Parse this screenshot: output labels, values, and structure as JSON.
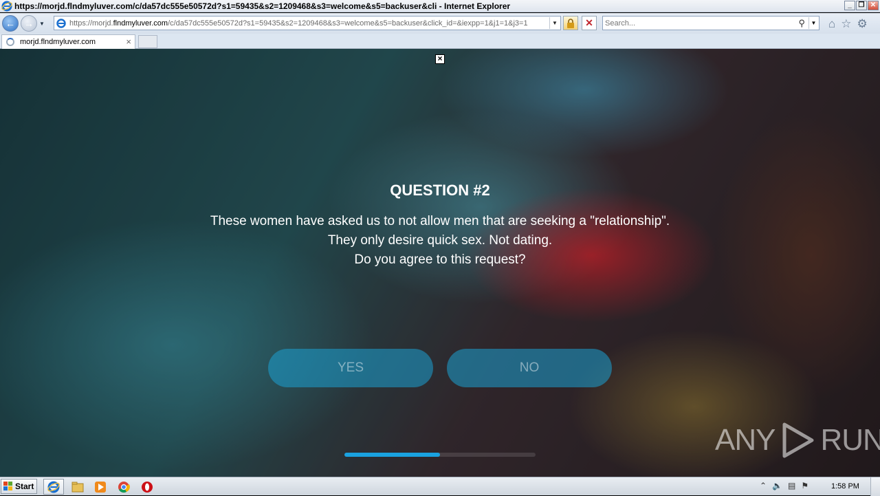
{
  "window": {
    "title": "https://morjd.flndmyluver.com/c/da57dc555e50572d?s1=59435&s2=1209468&s3=welcome&s5=backuser&cli - Internet Explorer",
    "min_label": "_",
    "max_label": "❐",
    "close_label": "✕"
  },
  "address_bar": {
    "url_prefix": "https://morjd.",
    "url_domain": "flndmyluver.com",
    "url_rest": "/c/da57dc555e50572d?s1=59435&s2=1209468&s3=welcome&s5=backuser&click_id=&iexpp=1&j1=1&j3=1"
  },
  "search": {
    "placeholder": "Search..."
  },
  "tabs": [
    {
      "label": "morjd.flndmyluver.com",
      "close": "×"
    }
  ],
  "page": {
    "close_label": "×",
    "question_title": "QUESTION #2",
    "question_lines": [
      "These women have asked us to not allow men that are seeking a \"relationship\".",
      "They only desire quick sex. Not dating.",
      "Do you agree to this request?"
    ],
    "yes_label": "YES",
    "no_label": "NO",
    "progress_fraction": 0.5,
    "watermark_left": "ANY",
    "watermark_right": "RUN",
    "accent_color": "#1aa2e0"
  },
  "taskbar": {
    "start_label": "Start",
    "apps": [
      "internet-explorer",
      "file-explorer",
      "media-player",
      "chrome",
      "opera"
    ],
    "clock": "1:58 PM"
  }
}
